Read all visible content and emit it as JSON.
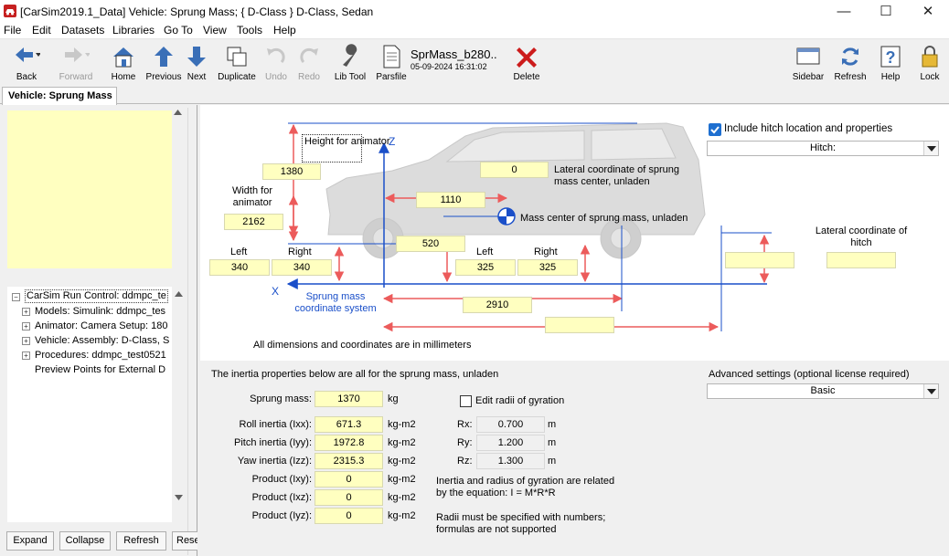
{
  "window": {
    "title": "[CarSim2019.1_Data] Vehicle: Sprung Mass; { D-Class } D-Class, Sedan"
  },
  "menu": [
    "File",
    "Edit",
    "Datasets",
    "Libraries",
    "Go To",
    "View",
    "Tools",
    "Help"
  ],
  "toolbar": {
    "back": "Back",
    "forward": "Forward",
    "home": "Home",
    "previous": "Previous",
    "next": "Next",
    "duplicate": "Duplicate",
    "undo": "Undo",
    "redo": "Redo",
    "libtool": "Lib Tool",
    "parsfile": "Parsfile",
    "dataset_name": "SprMass_b280..",
    "dataset_date": "05-09-2024 16:31:02",
    "delete": "Delete",
    "sidebar": "Sidebar",
    "refresh": "Refresh",
    "help": "Help",
    "lock": "Lock"
  },
  "tab": {
    "label": "Vehicle: Sprung Mass"
  },
  "tree": {
    "items": [
      "CarSim Run Control: ddmpc_te",
      "Models: Simulink: ddmpc_tes",
      "Animator: Camera Setup: 180",
      "Vehicle: Assembly: D-Class, S",
      "Procedures: ddmpc_test0521",
      "Preview Points for External D"
    ]
  },
  "left_buttons": {
    "expand": "Expand",
    "collapse": "Collapse",
    "refresh": "Refresh",
    "reset": "Rese"
  },
  "diagram": {
    "height_label": "Height for animator",
    "height_value": "1380",
    "width_label": "Width for animator",
    "width_value": "2162",
    "left": "Left",
    "right": "Right",
    "left_value": "340",
    "right_value": "340",
    "z_axis": "Z",
    "x_axis": "X",
    "sprung_coord": "Sprung mass coordinate system",
    "lateral_value": "0",
    "lateral_label": "Lateral coordinate of sprung mass center, unladen",
    "cg_x": "1110",
    "mass_center_label": "Mass center of sprung mass, unladen",
    "cg_height": "520",
    "rear_left": "Left",
    "rear_right": "Right",
    "rear_left_value": "325",
    "rear_right_value": "325",
    "wheelbase": "2910",
    "hitch_x": "",
    "hitch_z": "",
    "hitch_lat_label": "Lateral coordinate of hitch",
    "hitch_lat_value": "",
    "include_hitch": "Include hitch location and properties",
    "hitch_combo": "Hitch:",
    "units_note": "All dimensions and coordinates are in millimeters"
  },
  "inertia": {
    "heading": "The inertia properties below are all for the sprung mass, unladen",
    "mass_label": "Sprung mass:",
    "mass_value": "1370",
    "mass_unit": "kg",
    "edit_radii": "Edit radii of gyration",
    "rows": [
      {
        "label": "Roll inertia (Ixx):",
        "value": "671.3",
        "unit": "kg-m2"
      },
      {
        "label": "Pitch inertia (Iyy):",
        "value": "1972.8",
        "unit": "kg-m2"
      },
      {
        "label": "Yaw inertia (Izz):",
        "value": "2315.3",
        "unit": "kg-m2"
      },
      {
        "label": "Product (Ixy):",
        "value": "0",
        "unit": "kg-m2"
      },
      {
        "label": "Product (Ixz):",
        "value": "0",
        "unit": "kg-m2"
      },
      {
        "label": "Product (Iyz):",
        "value": "0",
        "unit": "kg-m2"
      }
    ],
    "radii": [
      {
        "label": "Rx:",
        "value": "0.700",
        "unit": "m"
      },
      {
        "label": "Ry:",
        "value": "1.200",
        "unit": "m"
      },
      {
        "label": "Rz:",
        "value": "1.300",
        "unit": "m"
      }
    ],
    "note1": "Inertia and radius of gyration are related by the equation: I = M*R*R",
    "note2": "Radii must be specified with numbers; formulas are not supported",
    "advanced_label": "Advanced settings (optional license required)",
    "advanced_value": "Basic"
  },
  "colors": {
    "field_yellow": "#ffffc0",
    "axis_blue": "#1a4fc9",
    "dimension_red": "#ec5b5b",
    "notes_yellow": "#ffffc0"
  }
}
